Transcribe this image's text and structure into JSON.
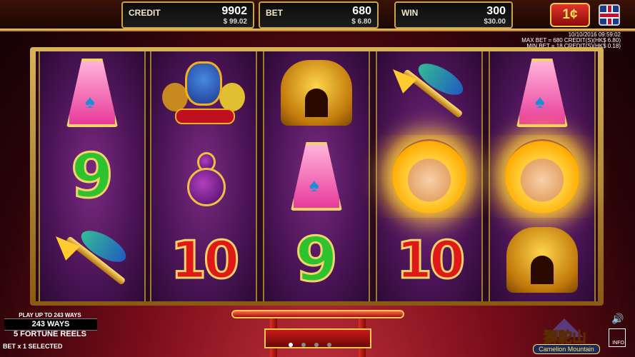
{
  "meters": {
    "credit": {
      "label": "CREDIT",
      "value": "9902",
      "sub": "$ 99.02"
    },
    "bet": {
      "label": "BET",
      "value": "680",
      "sub": "$ 6.80"
    },
    "win": {
      "label": "WIN",
      "value": "300",
      "sub": "$30.00"
    }
  },
  "denomination": "1¢",
  "info": {
    "datetime": "10/10/2016 09:59:02",
    "max_bet": "MAX BET = 680 CREDIT(S)(HK$ 6.80)",
    "min_bet": "MIN BET = 18 CREDIT(S)(HK$ 0.18)"
  },
  "reels": [
    [
      "A",
      "9",
      "spear"
    ],
    [
      "beasts",
      "gourd",
      "10"
    ],
    [
      "lion",
      "A",
      "9"
    ],
    [
      "spear",
      "monkey",
      "10"
    ],
    [
      "A",
      "monkey",
      "lion"
    ]
  ],
  "bottom_left": {
    "play_up": "PLAY UP TO 243 WAYS",
    "ways": "243 WAYS",
    "fortune": "5 FORTUNE REELS",
    "bet_selected": "BET x 1 SELECTED"
  },
  "logo": {
    "title": "獅駝山",
    "subtitle": "Camelion Mountain"
  },
  "info_button": "INFO",
  "page_dots": 4,
  "active_dot": 0,
  "colors": {
    "gold": "#c9a24a",
    "reel_purple": "#4a1456",
    "denom_red": "#e0342a"
  }
}
